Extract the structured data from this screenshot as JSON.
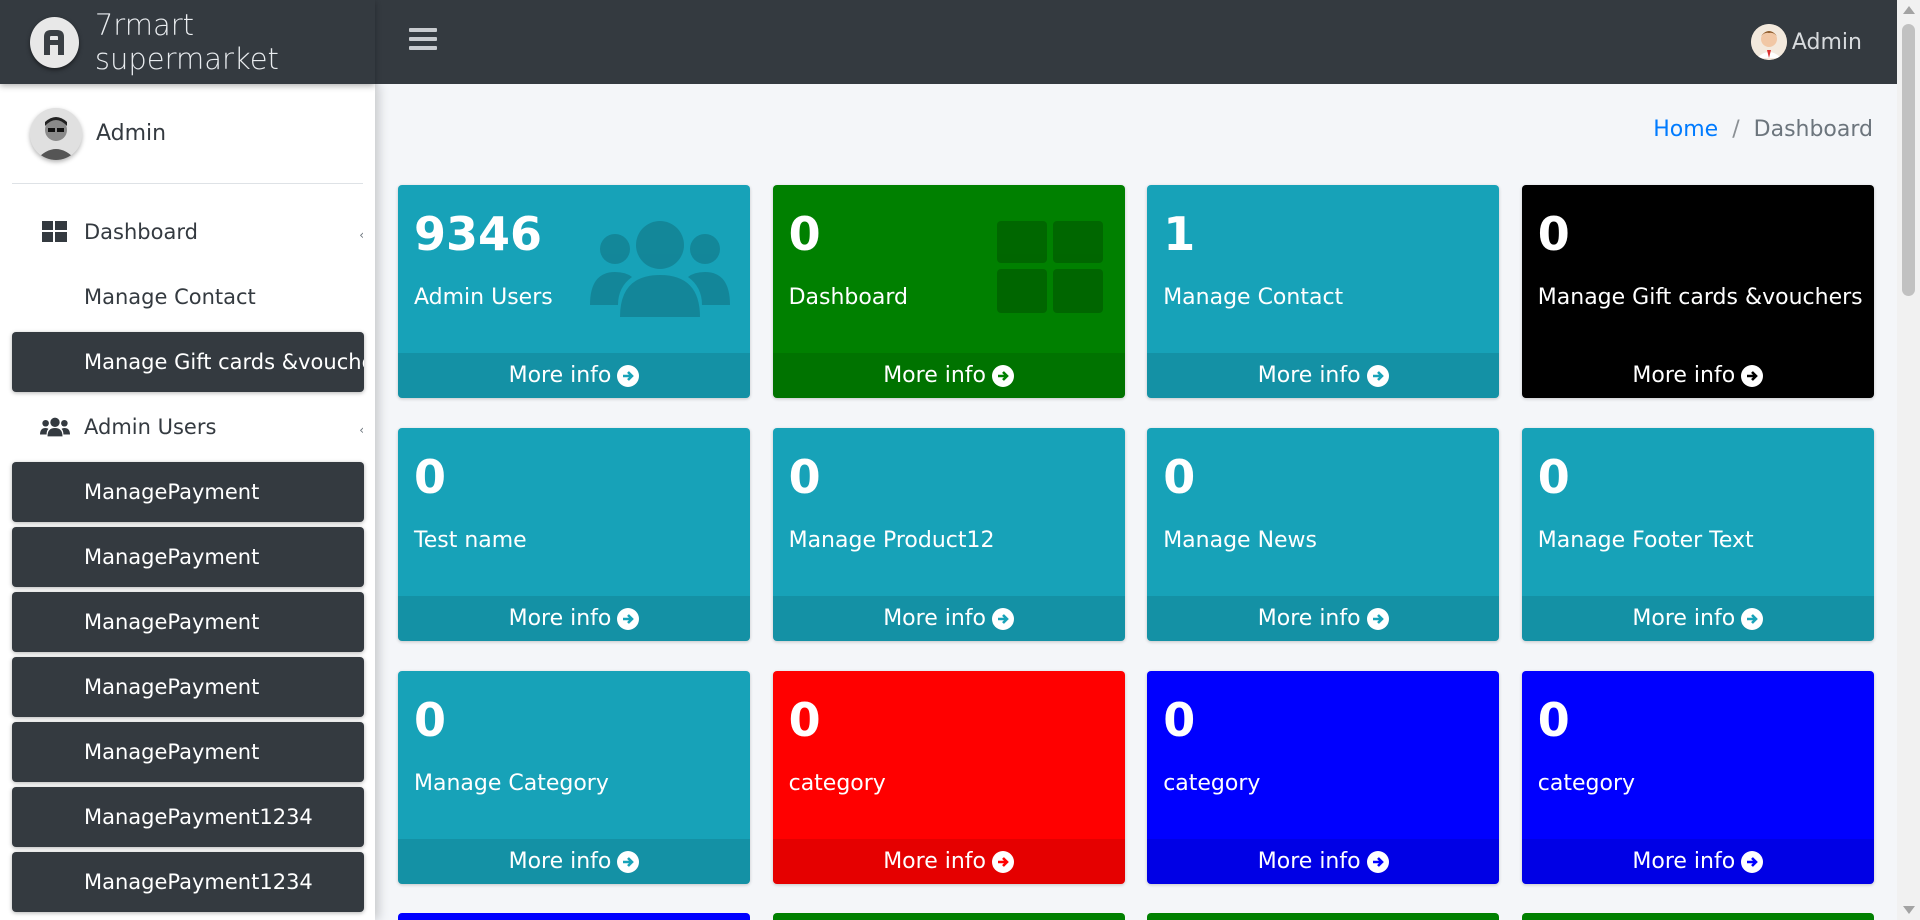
{
  "brand": {
    "name": "7rmart supermarket"
  },
  "navbar": {
    "user_name": "Admin"
  },
  "sidebar": {
    "user_name": "Admin",
    "items": [
      {
        "label": "Dashboard",
        "style": "plain",
        "icon": "dashboard-grid-icon"
      },
      {
        "label": "Manage Contact",
        "style": "plain"
      },
      {
        "label": "Manage Gift cards &vouchers",
        "style": "dark"
      },
      {
        "label": "Admin Users",
        "style": "plain",
        "icon": "users-icon"
      },
      {
        "label": "ManagePayment",
        "style": "dark"
      },
      {
        "label": "ManagePayment",
        "style": "dark"
      },
      {
        "label": "ManagePayment",
        "style": "dark"
      },
      {
        "label": "ManagePayment",
        "style": "dark"
      },
      {
        "label": "ManagePayment",
        "style": "dark"
      },
      {
        "label": "ManagePayment1234",
        "style": "dark"
      },
      {
        "label": "ManagePayment1234",
        "style": "dark"
      }
    ]
  },
  "breadcrumb": {
    "home": "Home",
    "separator": "/",
    "current": "Dashboard"
  },
  "cards": [
    {
      "count": "9346",
      "title": "Admin Users",
      "color": "teal",
      "icon": "users-icon",
      "footer": "More info"
    },
    {
      "count": "0",
      "title": "Dashboard",
      "color": "green",
      "icon": "dashboard-grid-icon",
      "footer": "More info"
    },
    {
      "count": "1",
      "title": "Manage Contact",
      "color": "teal",
      "footer": "More info"
    },
    {
      "count": "0",
      "title": "Manage Gift cards &vouchers",
      "color": "black",
      "footer": "More info"
    },
    {
      "count": "0",
      "title": "Test name",
      "color": "teal",
      "footer": "More info"
    },
    {
      "count": "0",
      "title": "Manage Product12",
      "color": "teal",
      "footer": "More info"
    },
    {
      "count": "0",
      "title": "Manage News",
      "color": "teal",
      "footer": "More info"
    },
    {
      "count": "0",
      "title": "Manage Footer Text",
      "color": "teal",
      "footer": "More info"
    },
    {
      "count": "0",
      "title": "Manage Category",
      "color": "teal",
      "footer": "More info"
    },
    {
      "count": "0",
      "title": "category",
      "color": "red",
      "footer": "More info"
    },
    {
      "count": "0",
      "title": "category",
      "color": "blue",
      "footer": "More info"
    },
    {
      "count": "0",
      "title": "category",
      "color": "blue",
      "footer": "More info"
    }
  ],
  "next_row_colors": [
    "#0000ff",
    "#008000",
    "#008000",
    "#008000"
  ]
}
